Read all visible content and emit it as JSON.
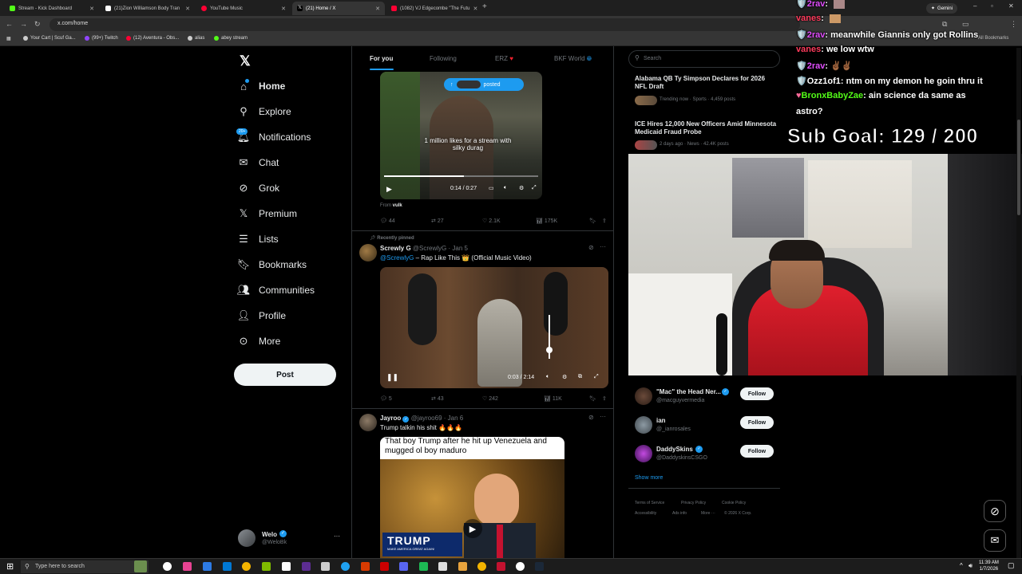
{
  "browser": {
    "tabs": [
      {
        "label": "Stream - Kick Dashboard",
        "color": "#53fc18"
      },
      {
        "label": "(21)Zion Williamson Body Tran",
        "color": "#ffffff"
      },
      {
        "label": "YouTube Music",
        "color": "#ff0033"
      },
      {
        "label": "(21) Home / X",
        "color": "#ffffff"
      },
      {
        "label": "(1082) VJ Edgecombe \"The Futu",
        "color": "#ff0033"
      }
    ],
    "url": "x.com/home",
    "gemini_label": "Gemini",
    "bookmarks": [
      "Your Cart | Scuf Ga...",
      "(99+) Twitch",
      "(12) Aventura - Obs...",
      "alias",
      "abey stream"
    ],
    "all_bookmarks": "All Bookmarks"
  },
  "nav": {
    "home": "Home",
    "explore": "Explore",
    "notifications": "Notifications",
    "notif_badge": "20+",
    "chat": "Chat",
    "grok": "Grok",
    "premium": "Premium",
    "lists": "Lists",
    "bookmarks": "Bookmarks",
    "communities": "Communities",
    "profile": "Profile",
    "more": "More",
    "post": "Post"
  },
  "account": {
    "name": "Welo",
    "handle": "@WeloBk"
  },
  "feed_tabs": [
    "For you",
    "Following",
    "ERZ",
    "BKF World"
  ],
  "tweet1": {
    "posted_label": "posted",
    "caption": "1 million likes for a stream with silky durag",
    "time": "0:14 / 0:27",
    "from_label": "From",
    "from_user": "vulk",
    "replies": "44",
    "reposts": "27",
    "likes": "2.1K",
    "views": "175K"
  },
  "tweet2": {
    "pinned_label": "Recently pinned",
    "name": "Screwly G",
    "handle": "@ScrewlyG",
    "date": "Jan 5",
    "mention": "@ScrewlyG",
    "text": " – Rap Like This 👑 (Official Music Video)",
    "time": "0:03 / 2:14",
    "replies": "5",
    "reposts": "43",
    "likes": "242",
    "views": "11K"
  },
  "tweet3": {
    "name": "Jayroo",
    "handle": "@jayroo69",
    "date": "Jan 6",
    "text": "Trump talkin his shit 🔥🔥🔥",
    "meme_text": "That boy Trump after he hit up Venezuela and mugged ol boy maduro",
    "trump_banner": "TRUMP",
    "trump_sub": "MAKE AMERICA GREAT AGAIN!"
  },
  "search_placeholder": "Search",
  "trends": [
    {
      "title": "Alabama QB Ty Simpson Declares for 2026 NFL Draft",
      "meta": "Trending now · Sports · 4,459 posts"
    },
    {
      "title": "ICE Hires 12,000 New Officers Amid Minnesota Medicaid Fraud Probe",
      "meta": "2 days ago · News · 42.4K posts"
    }
  ],
  "who_to_follow": [
    {
      "name": "\"Mac\" the Head Ner...",
      "handle": "@macguyvermedia",
      "button": "Follow"
    },
    {
      "name": "ian",
      "handle": "@_ianrosales",
      "button": "Follow"
    },
    {
      "name": "DaddySkins",
      "handle": "@DaddyskinsCSGO",
      "button": "Follow"
    }
  ],
  "show_more": "Show more",
  "footer": [
    "Terms of Service",
    "Privacy Policy",
    "Cookie Policy",
    "Accessibility",
    "Ads info",
    "More ···",
    "© 2026 X Corp."
  ],
  "chat": [
    {
      "user": "2rav",
      "sep": ":",
      "msg": "",
      "user_color": "#e14eff"
    },
    {
      "user": "vanes",
      "sep": ":",
      "msg": "",
      "user_color": "#ff3b5c"
    },
    {
      "user": "2rav",
      "sep": ":",
      "msg": "meanwhile Giannis only got Rollins",
      "user_color": "#e14eff"
    },
    {
      "user": "vanes",
      "sep": ":",
      "msg": "we low wtw",
      "user_color": "#ff3b5c"
    },
    {
      "user": "2rav",
      "sep": ":",
      "msg": "✌🏾✌🏾",
      "user_color": "#e14eff"
    },
    {
      "user": "Ozz1of1",
      "sep": ":",
      "msg": "ntm on my demon he goin thru it",
      "user_color": "#ffffff"
    },
    {
      "user": "BronxBabyZae",
      "sep": ":",
      "msg": "ain science da same as",
      "user_color": "#53fc18"
    },
    {
      "user": "",
      "sep": "",
      "msg": "astro?",
      "user_color": "#ffffff"
    }
  ],
  "sub_goal": "Sub Goal:  129 / 200",
  "taskbar": {
    "search": "Type here to search",
    "time": "11:39 AM",
    "date": "1/7/2026"
  }
}
